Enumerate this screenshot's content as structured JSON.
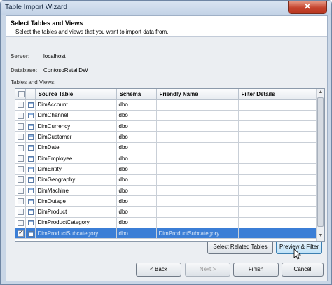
{
  "window": {
    "title": "Table Import Wizard",
    "close_glyph": "✕"
  },
  "header": {
    "title": "Select Tables and Views",
    "subtitle": "Select the tables and views that you want to import data from."
  },
  "connection": {
    "server_label": "Server:",
    "server_value": "localhost",
    "database_label": "Database:",
    "database_value": "ContosoRetailDW",
    "list_label": "Tables and Views:"
  },
  "table": {
    "columns": [
      "Source Table",
      "Schema",
      "Friendly Name",
      "Filter Details"
    ],
    "rows": [
      {
        "checked": false,
        "source": "DimAccount",
        "schema": "dbo",
        "friendly": "",
        "filter": ""
      },
      {
        "checked": false,
        "source": "DimChannel",
        "schema": "dbo",
        "friendly": "",
        "filter": ""
      },
      {
        "checked": false,
        "source": "DimCurrency",
        "schema": "dbo",
        "friendly": "",
        "filter": ""
      },
      {
        "checked": false,
        "source": "DimCustomer",
        "schema": "dbo",
        "friendly": "",
        "filter": ""
      },
      {
        "checked": false,
        "source": "DimDate",
        "schema": "dbo",
        "friendly": "",
        "filter": ""
      },
      {
        "checked": false,
        "source": "DimEmployee",
        "schema": "dbo",
        "friendly": "",
        "filter": ""
      },
      {
        "checked": false,
        "source": "DimEntity",
        "schema": "dbo",
        "friendly": "",
        "filter": ""
      },
      {
        "checked": false,
        "source": "DimGeography",
        "schema": "dbo",
        "friendly": "",
        "filter": ""
      },
      {
        "checked": false,
        "source": "DimMachine",
        "schema": "dbo",
        "friendly": "",
        "filter": ""
      },
      {
        "checked": false,
        "source": "DimOutage",
        "schema": "dbo",
        "friendly": "",
        "filter": ""
      },
      {
        "checked": false,
        "source": "DimProduct",
        "schema": "dbo",
        "friendly": "",
        "filter": ""
      },
      {
        "checked": false,
        "source": "DimProductCategory",
        "schema": "dbo",
        "friendly": "",
        "filter": ""
      },
      {
        "checked": true,
        "source": "DimProductSubcategory",
        "schema": "dbo",
        "friendly": "DimProductSubcategory",
        "filter": "",
        "selected": true
      }
    ]
  },
  "buttons": {
    "select_related": "Select Related Tables",
    "preview_filter": "Preview & Filter",
    "back": "< Back",
    "next": "Next >",
    "finish": "Finish",
    "cancel": "Cancel"
  }
}
